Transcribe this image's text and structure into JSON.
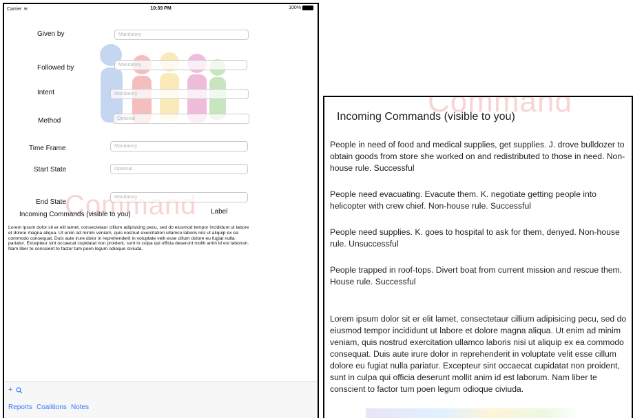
{
  "status_bar": {
    "carrier": "Carrier",
    "time": "10:39 PM",
    "battery": "100%"
  },
  "form": {
    "watermark": "Command",
    "fields": [
      {
        "label": "Given by",
        "placeholder": "Mandatory"
      },
      {
        "label": "Followed by",
        "placeholder": "Mandatory"
      },
      {
        "label": "Intent",
        "placeholder": "Mandatory"
      },
      {
        "label": "Method",
        "placeholder": "Optional"
      },
      {
        "label": "Time Frame",
        "placeholder": "Mandatory"
      },
      {
        "label": "Start State",
        "placeholder": "Optional"
      },
      {
        "label": "End State",
        "placeholder": "Mandatory"
      }
    ],
    "incoming_label": "Incoming Commands (visible to you)",
    "side_label": "Label",
    "lorem": "Lorem ipsum dolor sit er elit lamet, consectetaur cillium adipisicing pecu, sed do eiusmod tempor incididunt ut labore et dolore magna aliqua. Ut enim ad minim veniam, quis nostrud exercitation ullamco laboris nisi ut aliquip ex ea commodo consequat. Duis aute irure dolor in reprehenderit in voluptate velit esse cillum dolore eu fugiat nulla pariatur. Excepteur sint occaecat cupidatat non proident, sunt in culpa qui officia deserunt mollit anim id est laborum. Nam liber te conscient to factor tum poen legum odioque civiuda."
  },
  "toolbar": {
    "add_icon": "+",
    "search_icon": "search-icon",
    "links": [
      "Reports",
      "Coalitions",
      "Notes"
    ]
  },
  "detail": {
    "watermark": "Command",
    "title": "Incoming Commands (visible to you)",
    "commands": [
      "People in need of food and medical supplies, get supplies. J. drove bulldozer to obtain goods from store she worked on and redistributed to those in need. Non-house rule. Successful",
      "People need evacuating. Evacute them. K. negotiate getting people into helicopter with crew chief. Non-house rule. Successful",
      "People need supplies. K. goes to hospital to ask for them, denyed. Non-house rule. Unsuccessful",
      "People trapped in roof-tops. Divert boat from current mission and rescue them. House rule. Successful"
    ],
    "lorem": "Lorem ipsum dolor sit er elit lamet, consectetaur cillium adipisicing pecu, sed do eiusmod tempor incididunt ut labore et dolore magna aliqua. Ut enim ad minim veniam, quis nostrud exercitation ullamco laboris nisi ut aliquip ex ea commodo consequat. Duis aute irure dolor in reprehenderit in voluptate velit esse cillum dolore eu fugiat nulla pariatur. Excepteur sint occaecat cupidatat non proident, sunt in culpa qui officia deserunt mollit anim id est laborum. Nam liber te conscient to factor tum poen legum odioque civiuda."
  }
}
